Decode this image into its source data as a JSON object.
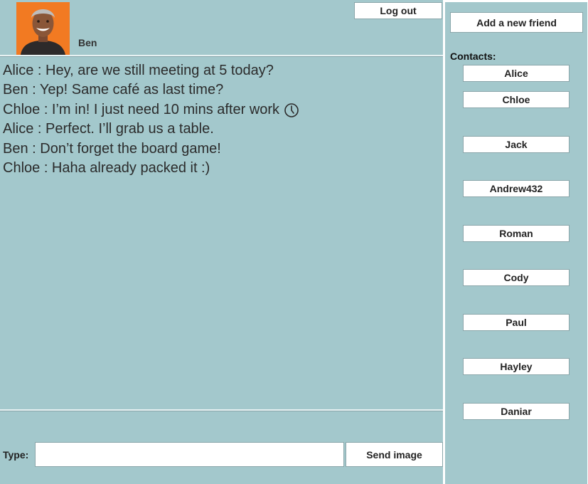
{
  "header": {
    "user_name": "Ben",
    "logout_label": "Log out"
  },
  "chat": {
    "messages": [
      {
        "text": "Alice : Hey, are we still meeting at 5 today?"
      },
      {
        "text": "Ben : Yep! Same café as last time?"
      },
      {
        "text": "Chloe : I’m in! I just need 10 mins after work",
        "icon": "clock-icon"
      },
      {
        "text": "Alice : Perfect. I’ll grab us a table."
      },
      {
        "text": "Ben : Don’t forget the board game!"
      },
      {
        "text": "Chloe : Haha already packed it :)"
      }
    ]
  },
  "composer": {
    "type_label": "Type:",
    "input_value": "",
    "send_image_label": "Send image"
  },
  "sidebar": {
    "add_friend_label": "Add a new friend",
    "contacts_label": "Contacts:",
    "contacts": [
      "Alice",
      "Chloe",
      "Jack",
      "Andrew432",
      "Roman",
      "Cody",
      "Paul",
      "Hayley",
      "Daniar"
    ]
  },
  "colors": {
    "panel_background": "#a3c8cc",
    "button_background": "#ffffff",
    "avatar_background": "#f27a22"
  }
}
